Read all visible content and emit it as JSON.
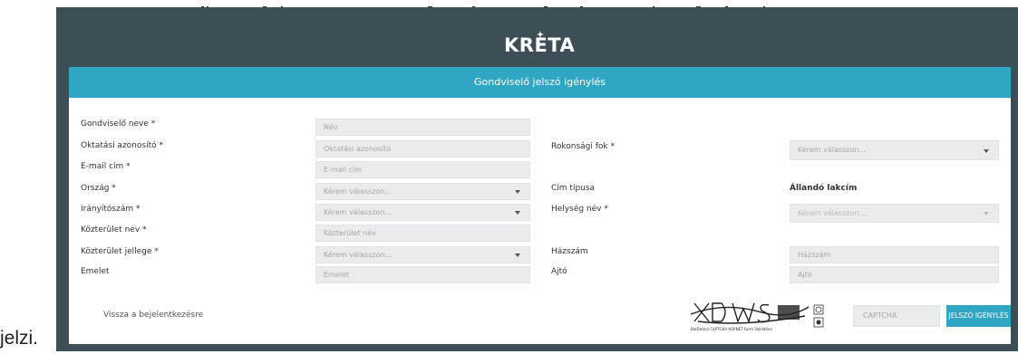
{
  "document": {
    "trailing_word": "jelzi."
  },
  "app": {
    "logo_text": "KRETA"
  },
  "form": {
    "title": "Gondviselő jelszó igénylés",
    "left_fields": [
      {
        "label": "Gondviselő neve *",
        "placeholder": "Név",
        "type": "text"
      },
      {
        "label": "Oktatási azonosító *",
        "placeholder": "Oktatási azonosító",
        "type": "text"
      },
      {
        "label": "E-mail cím *",
        "placeholder": "E-mail cím",
        "type": "text"
      },
      {
        "label": "Ország *",
        "placeholder": "Kérem válasszon...",
        "type": "select"
      },
      {
        "label": "Irányítószám *",
        "placeholder": "Kérem válasszon...",
        "type": "select"
      },
      {
        "label": "Közterület név *",
        "placeholder": "Közterület név",
        "type": "text"
      },
      {
        "label": "Közterület jellege *",
        "placeholder": "Kérem válasszon...",
        "type": "select"
      },
      {
        "label": "Emelet",
        "placeholder": "Emelet",
        "type": "text"
      }
    ],
    "right_fields": {
      "relationship": {
        "label": "Rokonsági fok *",
        "placeholder": "Kérem válasszon..."
      },
      "address_type": {
        "label": "Cím típusa",
        "value": "Állandó lakcím"
      },
      "city": {
        "label": "Helység név *",
        "placeholder": "Kérem válasszon..."
      },
      "house_number": {
        "label": "Házszám",
        "placeholder": "Házszám"
      },
      "door": {
        "label": "Ajtó",
        "placeholder": "Ajtó"
      }
    },
    "footer": {
      "back_link": "Vissza a bejelentkezésre",
      "captcha_placeholder": "CAPTCHA",
      "captcha_caption": "BotDetect CAPTCHA ASP.NET Form Validation",
      "captcha_text": "XDWS",
      "submit_label": "JELSZÓ IGÉNYLÉS"
    }
  },
  "colors": {
    "frame": "#3e4e57",
    "accent": "#2fa6c4",
    "input_bg": "#e9ebed"
  }
}
